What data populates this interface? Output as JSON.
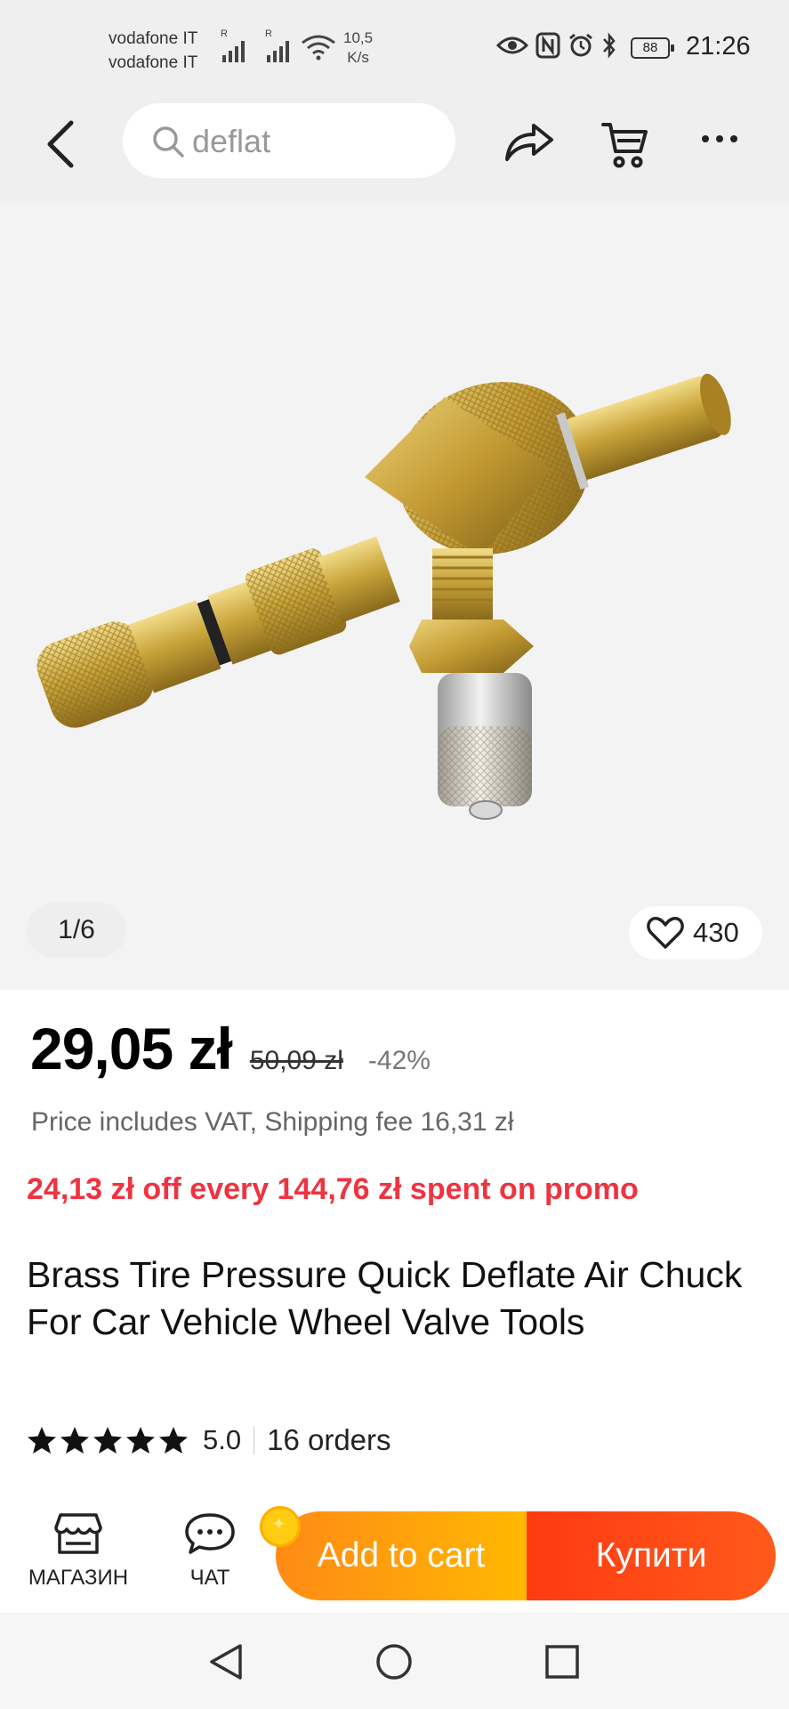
{
  "status_bar": {
    "carrier_1": "vodafone IT",
    "carrier_2": "vodafone IT",
    "speed_value": "10,5",
    "speed_unit": "K/s",
    "battery": "88",
    "time": "21:26"
  },
  "search": {
    "query": "deflat"
  },
  "gallery": {
    "counter": "1/6",
    "likes": "430"
  },
  "product": {
    "price": "29,05 zł",
    "old_price": "50,09 zł",
    "discount": "-42%",
    "vat_note": "Price includes VAT, Shipping fee 16,31 zł",
    "promo": "24,13 zł off every 144,76 zł spent on promo",
    "title": "Brass Tire Pressure Quick Deflate Air Chuck For Car Vehicle Wheel Valve Tools",
    "rating": "5.0",
    "stars": 5,
    "orders": "16 orders"
  },
  "bottom_bar": {
    "store_label": "МАГАЗИН",
    "chat_label": "ЧАТ",
    "add_to_cart": "Add to cart",
    "buy": "Купити"
  },
  "colors": {
    "promo": "#ef3340",
    "add_to_cart_start": "#ff8a16",
    "add_to_cart_end": "#ffb800",
    "buy": "#ff3a12"
  }
}
